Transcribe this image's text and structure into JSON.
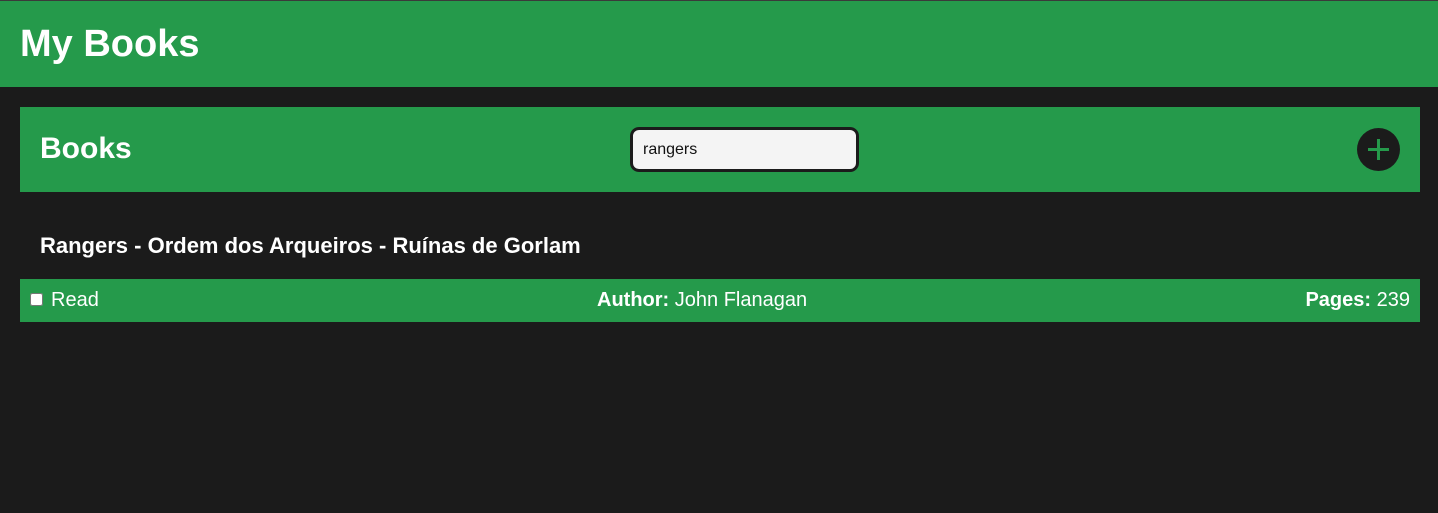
{
  "header": {
    "app_title": "My Books"
  },
  "books_bar": {
    "title": "Books",
    "search": {
      "value": "rangers",
      "placeholder": ""
    },
    "add_icon": "plus-icon"
  },
  "books": [
    {
      "title": "Rangers - Ordem dos Arqueiros - Ruínas de Gorlam",
      "read_label": "Read",
      "read_checked": false,
      "author_label": "Author:",
      "author": "John Flanagan",
      "pages_label": "Pages:",
      "pages": "239"
    }
  ],
  "colors": {
    "accent": "#259a4b",
    "background": "#1b1b1b",
    "text": "#ffffff"
  }
}
